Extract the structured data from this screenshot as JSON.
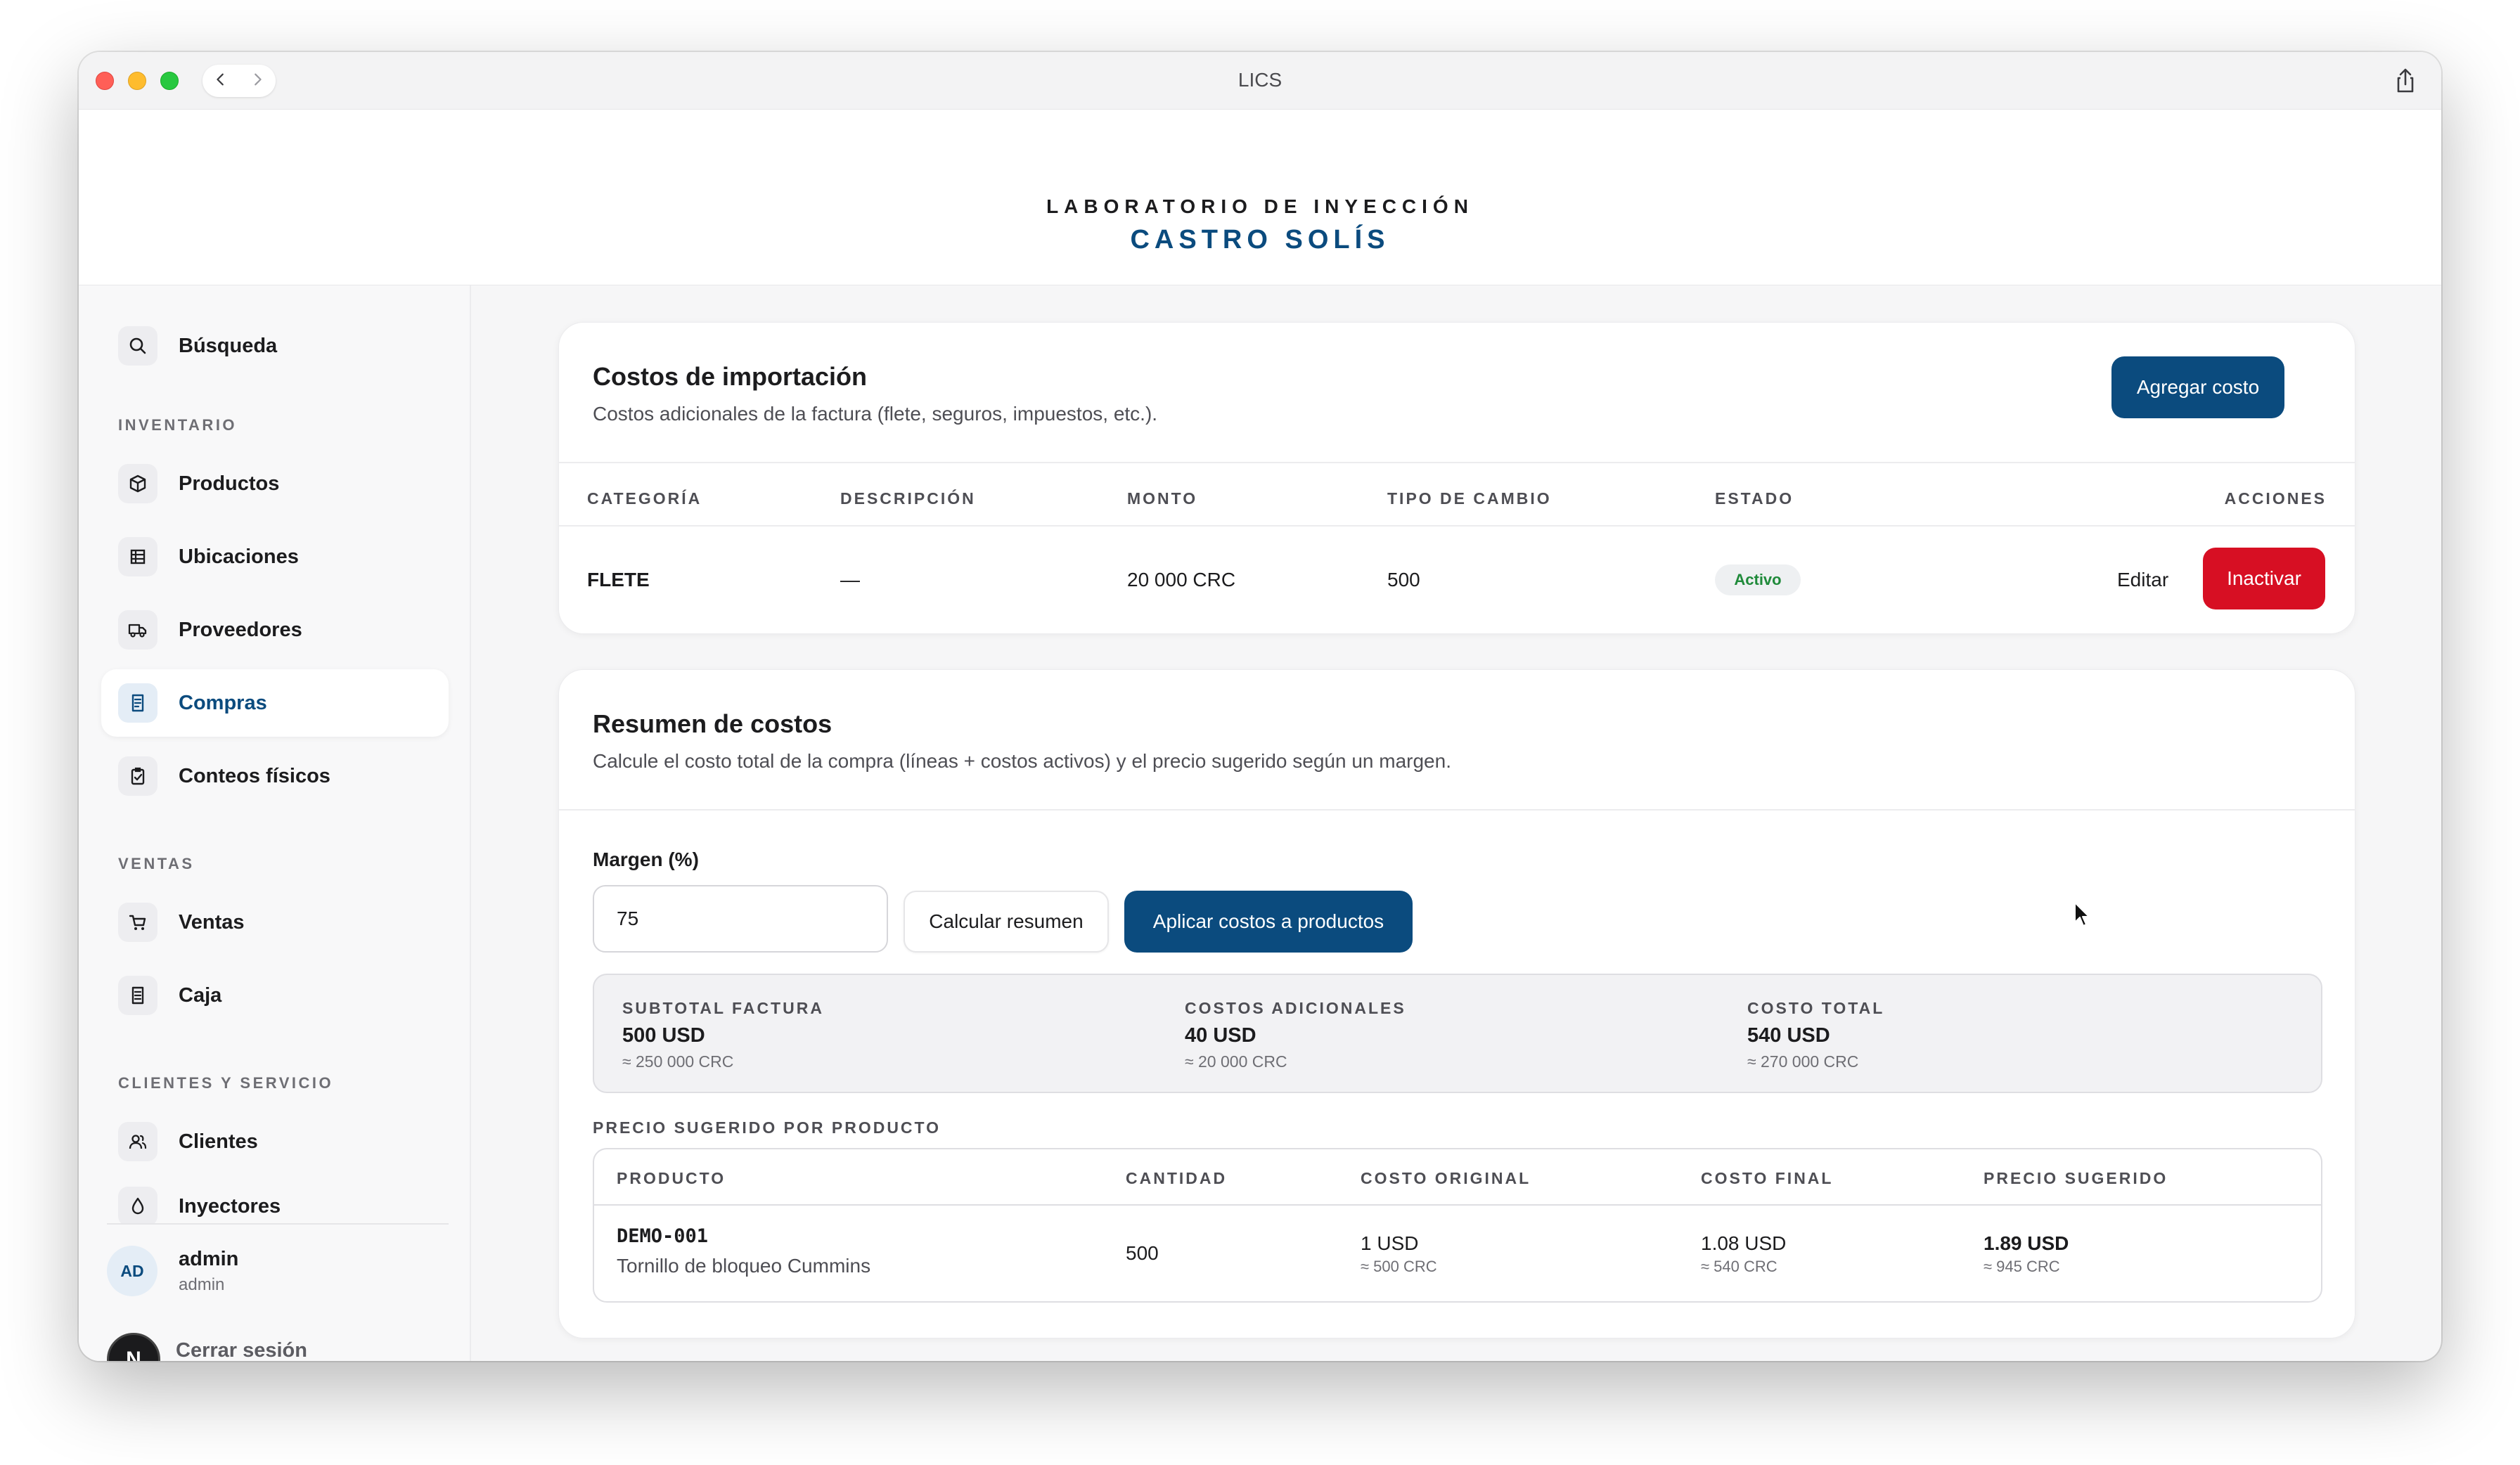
{
  "window": {
    "title": "LICS"
  },
  "header": {
    "brand_top": "LABORATORIO DE INYECCIÓN",
    "brand_bottom": "CASTRO SOLÍS"
  },
  "sidebar": {
    "search_label": "Búsqueda",
    "sections": {
      "inventario": "INVENTARIO",
      "ventas": "VENTAS",
      "clientes": "CLIENTES Y SERVICIO"
    },
    "items": {
      "productos": "Productos",
      "ubicaciones": "Ubicaciones",
      "proveedores": "Proveedores",
      "compras": "Compras",
      "conteos": "Conteos físicos",
      "ventas": "Ventas",
      "caja": "Caja",
      "clientes": "Clientes",
      "inyectores": "Inyectores"
    },
    "user": {
      "initials": "AD",
      "name": "admin",
      "role": "admin"
    },
    "logout_badge": "N",
    "logout_label": "Cerrar sesión"
  },
  "import_costs": {
    "title": "Costos de importación",
    "subtitle": "Costos adicionales de la factura (flete, seguros, impuestos, etc.).",
    "add_button": "Agregar costo",
    "columns": [
      "CATEGORÍA",
      "DESCRIPCIÓN",
      "MONTO",
      "TIPO DE CAMBIO",
      "ESTADO",
      "ACCIONES"
    ],
    "rows": [
      {
        "categoria": "FLETE",
        "descripcion": "—",
        "monto": "20 000 CRC",
        "tipo_cambio": "500",
        "estado": "Activo",
        "edit_label": "Editar",
        "deactivate_label": "Inactivar"
      }
    ]
  },
  "summary": {
    "title": "Resumen de costos",
    "subtitle": "Calcule el costo total de la compra (líneas + costos activos) y el precio sugerido según un margen.",
    "margin_label": "Margen (%)",
    "margin_value": "75",
    "calc_button": "Calcular resumen",
    "apply_button": "Aplicar costos a productos",
    "stats": [
      {
        "label": "SUBTOTAL FACTURA",
        "value": "500 USD",
        "conv": "≈ 250 000 CRC"
      },
      {
        "label": "COSTOS ADICIONALES",
        "value": "40 USD",
        "conv": "≈ 20 000 CRC"
      },
      {
        "label": "COSTO TOTAL",
        "value": "540 USD",
        "conv": "≈ 270 000 CRC"
      }
    ],
    "suggested_title": "PRECIO SUGERIDO POR PRODUCTO",
    "columns": [
      "PRODUCTO",
      "CANTIDAD",
      "COSTO ORIGINAL",
      "COSTO FINAL",
      "PRECIO SUGERIDO"
    ],
    "rows": [
      {
        "code": "DEMO-001",
        "name": "Tornillo de bloqueo Cummins",
        "cantidad": "500",
        "costo_original": "1 USD",
        "costo_original_conv": "≈ 500 CRC",
        "costo_final": "1.08 USD",
        "costo_final_conv": "≈ 540 CRC",
        "precio_sugerido": "1.89 USD",
        "precio_sugerido_conv": "≈ 945 CRC"
      }
    ]
  },
  "colors": {
    "brand": "#0b4b7e",
    "danger": "#d70f23",
    "active": "#1f8a3a"
  },
  "icons": [
    "search-icon",
    "box-icon",
    "grid-icon",
    "truck-icon",
    "receipt-icon",
    "clipboard-check-icon",
    "cart-icon",
    "register-icon",
    "users-icon",
    "drop-icon",
    "share-icon",
    "chevron-left-icon",
    "chevron-right-icon",
    "cursor-icon"
  ]
}
